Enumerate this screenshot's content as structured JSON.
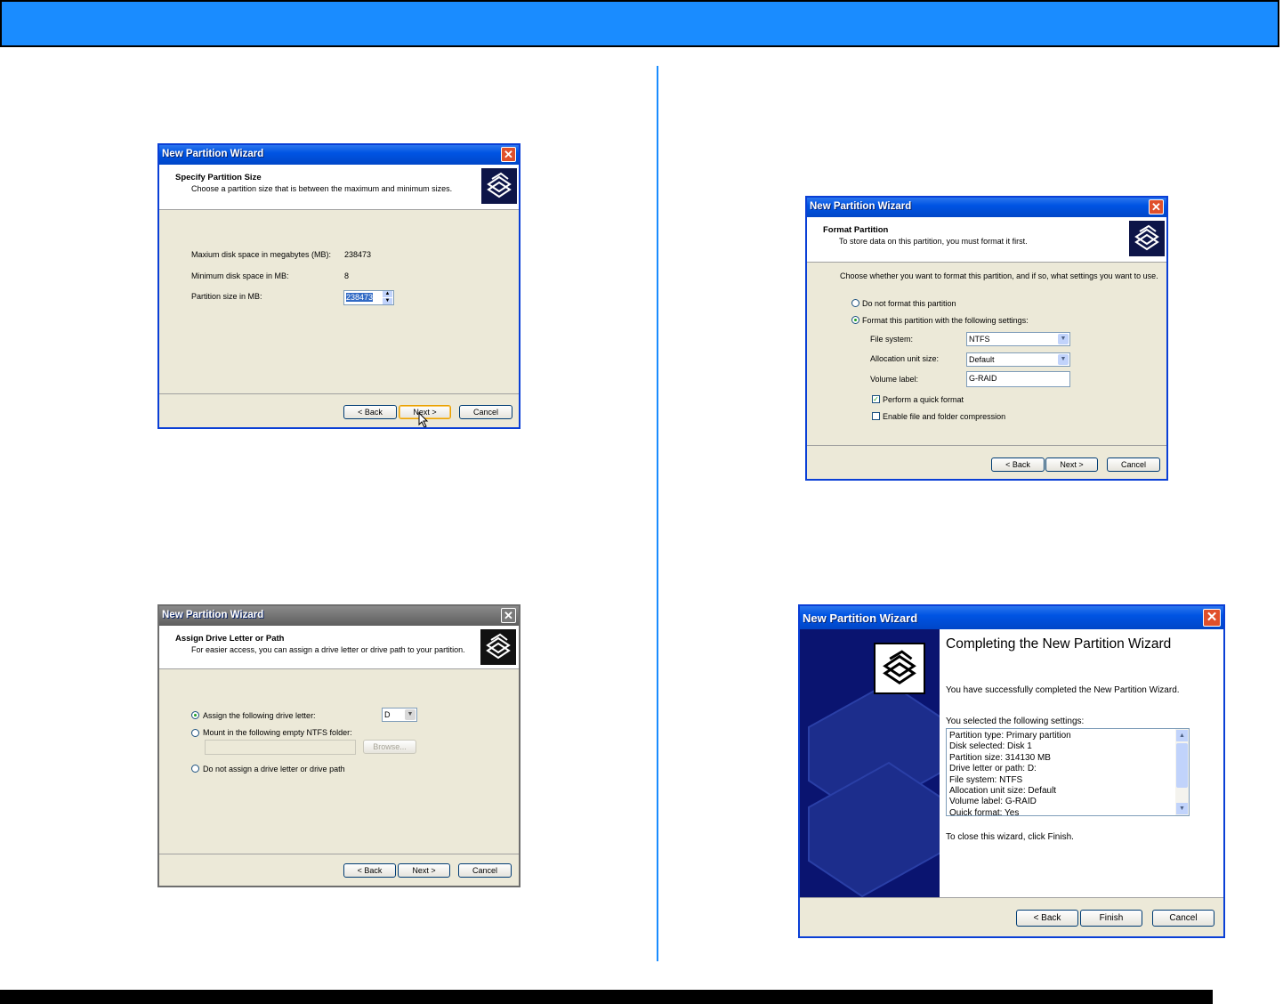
{
  "dialog_title": "New Partition Wizard",
  "size_dialog": {
    "heading": "Specify Partition Size",
    "subheading": "Choose a partition size that is between the maximum and minimum sizes.",
    "max_label": "Maxium disk space in megabytes (MB):",
    "max_value": "238473",
    "min_label": "Minimum disk space in MB:",
    "min_value": "8",
    "size_label": "Partition size in MB:",
    "size_value": "238473",
    "back": "< Back",
    "next": "Next >",
    "cancel": "Cancel"
  },
  "drive_dialog": {
    "heading": "Assign Drive Letter or Path",
    "subheading": "For easier access, you can assign a drive letter or drive path to your partition.",
    "opt_assign": "Assign the following drive letter:",
    "drive_letter": "D",
    "opt_mount": "Mount in the following empty NTFS folder:",
    "browse": "Browse...",
    "opt_none": "Do not assign a drive letter or drive path",
    "back": "< Back",
    "next": "Next >",
    "cancel": "Cancel"
  },
  "format_dialog": {
    "heading": "Format Partition",
    "subheading": "To store data on this partition, you must format it first.",
    "intro": "Choose whether you want to format this partition, and if so, what settings you want to use.",
    "opt_noformat": "Do not format this partition",
    "opt_format": "Format this partition with the following settings:",
    "fs_label": "File system:",
    "fs_value": "NTFS",
    "alloc_label": "Allocation unit size:",
    "alloc_value": "Default",
    "vol_label": "Volume label:",
    "vol_value": "G-RAID",
    "quick_label": "Perform a quick format",
    "compress_label": "Enable file and folder compression",
    "back": "< Back",
    "next": "Next >",
    "cancel": "Cancel"
  },
  "complete_dialog": {
    "heading": "Completing the New Partition Wizard",
    "success": "You have successfully completed the New Partition Wizard.",
    "selected_label": "You selected the following settings:",
    "settings": [
      "Partition type: Primary partition",
      "Disk selected: Disk 1",
      "Partition size: 314130 MB",
      "Drive letter or path: D:",
      "File system: NTFS",
      "Allocation unit size: Default",
      "Volume label: G-RAID",
      "Quick format: Yes"
    ],
    "close_text": "To close this wizard, click Finish.",
    "back": "< Back",
    "finish": "Finish",
    "cancel": "Cancel"
  }
}
